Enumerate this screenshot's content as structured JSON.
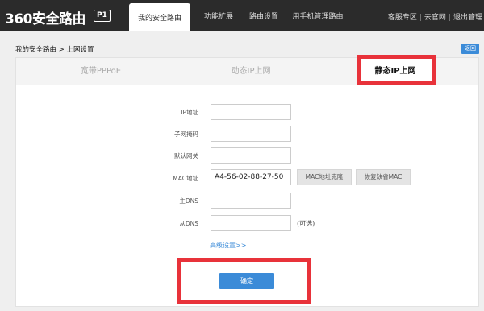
{
  "header": {
    "logo_text": "360安全路由",
    "logo_badge": "P1",
    "nav": [
      {
        "label": "我的安全路由",
        "active": true
      },
      {
        "label": "功能扩展",
        "active": false
      },
      {
        "label": "路由设置",
        "active": false
      },
      {
        "label": "用手机管理路由",
        "active": false
      }
    ],
    "links": [
      "客服专区",
      "去官网",
      "退出管理"
    ]
  },
  "breadcrumb": "我的安全路由 > 上网设置",
  "back_label": "返回",
  "tabs": [
    {
      "label": "宽带PPPoE",
      "active": false
    },
    {
      "label": "动态IP上网",
      "active": false
    },
    {
      "label": "静态IP上网",
      "active": true
    }
  ],
  "form": {
    "ip_label": "IP地址",
    "ip_value": "",
    "mask_label": "子网掩码",
    "mask_value": "",
    "gateway_label": "默认网关",
    "gateway_value": "",
    "mac_label": "MAC地址",
    "mac_value": "A4-56-02-88-27-50",
    "mac_clone_label": "MAC地址克隆",
    "mac_restore_label": "恢复缺省MAC",
    "dns1_label": "主DNS",
    "dns1_value": "",
    "dns2_label": "从DNS",
    "dns2_value": "",
    "optional_label": "(可选)",
    "advanced_label": "高级设置>>",
    "confirm_label": "确定"
  },
  "colors": {
    "topbar": "#2b2b2b",
    "accent": "#3b8bd8",
    "highlight": "#e8323a"
  }
}
